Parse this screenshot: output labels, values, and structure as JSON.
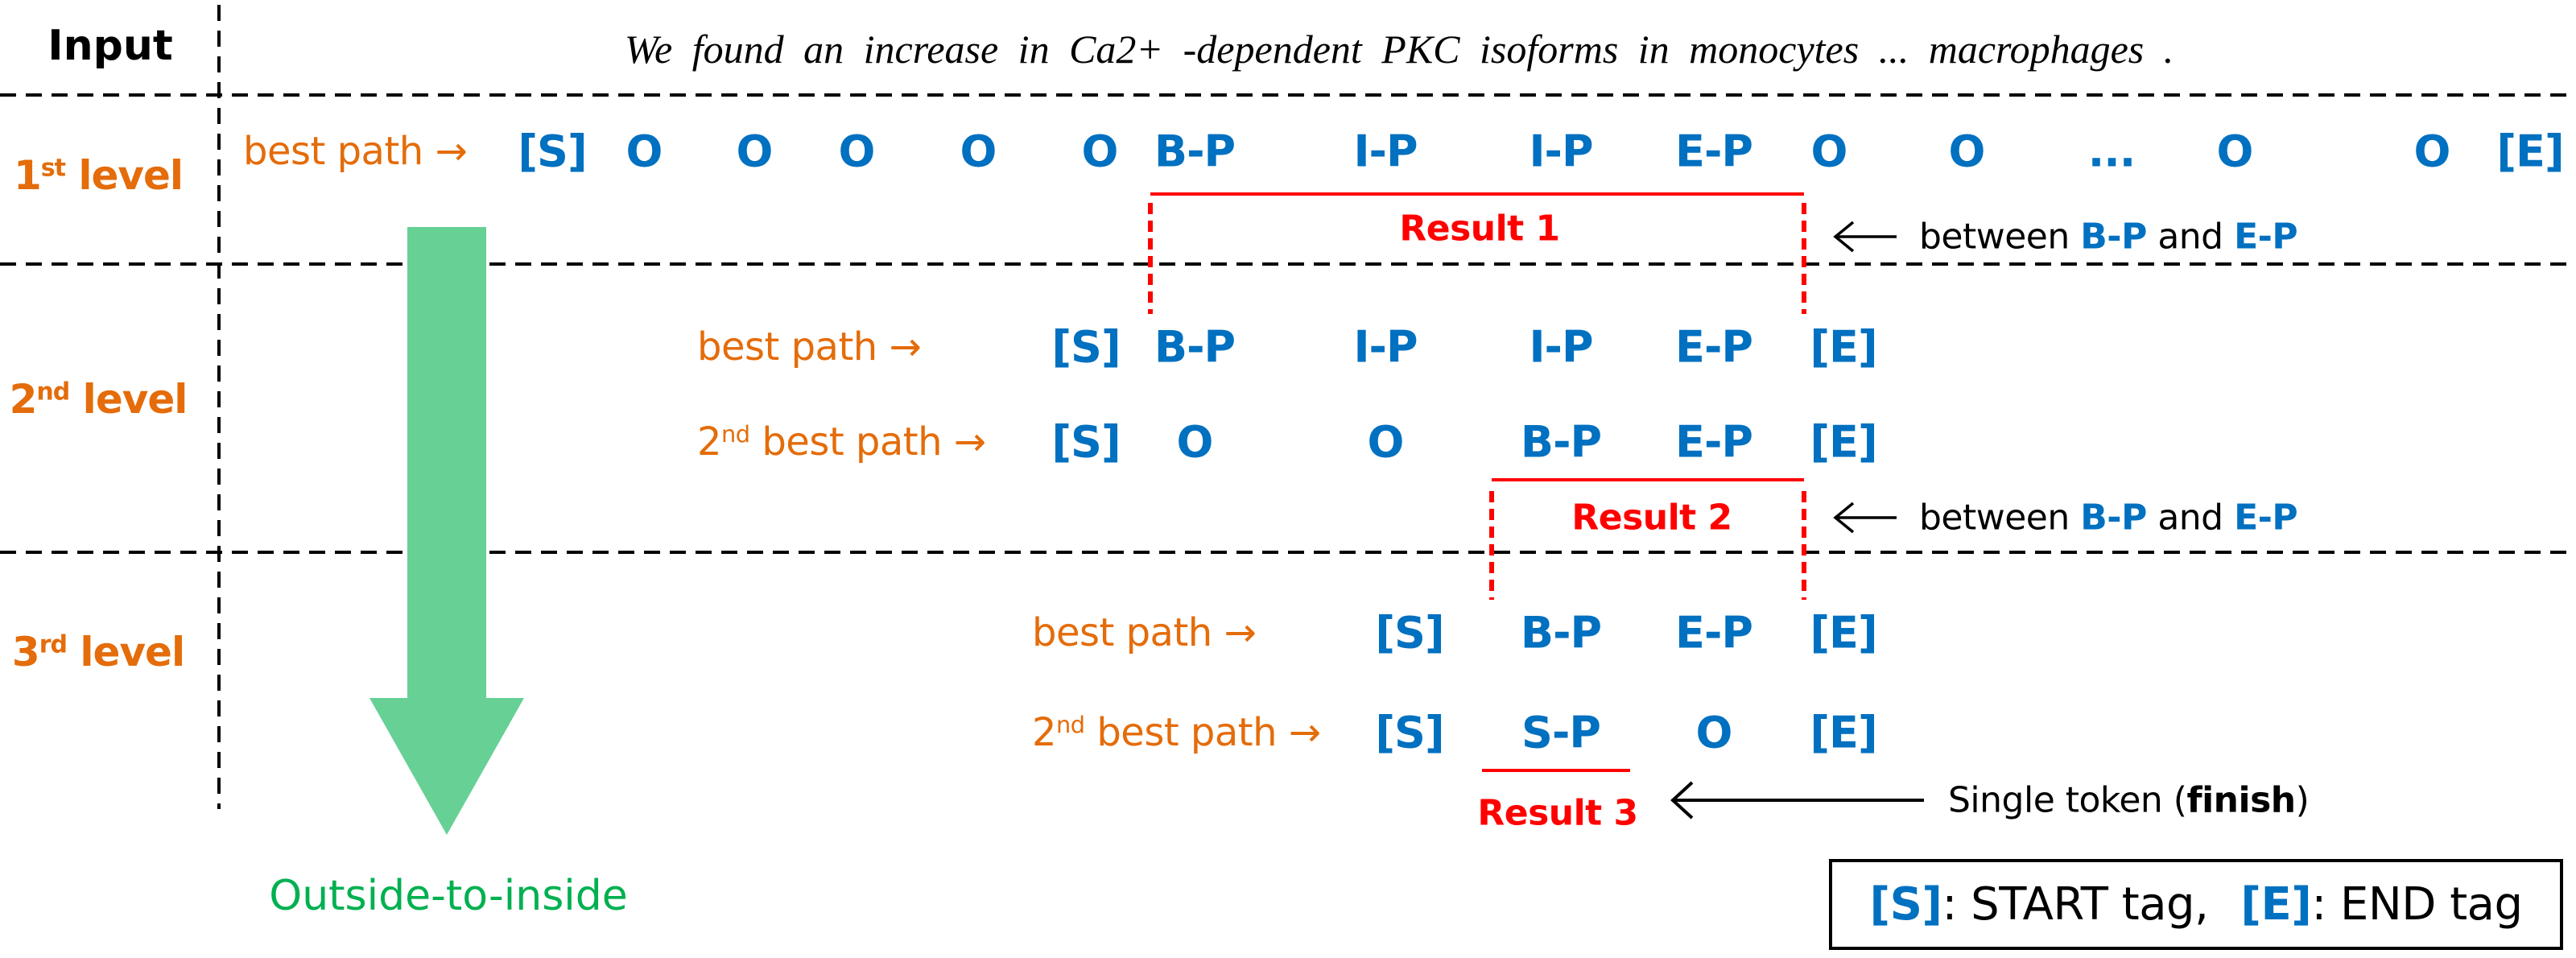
{
  "input_row": {
    "label": "Input",
    "sentence": "We found an increase in Ca2+ -dependent PKC isoforms in monocytes ... macrophages ."
  },
  "levels": [
    {
      "num": "1",
      "suffix": "st",
      "word": "level"
    },
    {
      "num": "2",
      "suffix": "nd",
      "word": "level"
    },
    {
      "num": "3",
      "suffix": "rd",
      "word": "level"
    }
  ],
  "paths": {
    "best": "best path →",
    "second_prefix": "2",
    "second_suffix": "nd",
    "second_rest": " best path →"
  },
  "level1": {
    "best_tokens": [
      "[S]",
      "O",
      "O",
      "O",
      "O",
      "O",
      "B-P",
      "I-P",
      "I-P",
      "E-P",
      "O",
      "O",
      "...",
      "O",
      "O",
      "[E]"
    ]
  },
  "level2": {
    "best_tokens": [
      "[S]",
      "B-P",
      "I-P",
      "I-P",
      "E-P",
      "[E]"
    ],
    "second_tokens": [
      "[S]",
      "O",
      "O",
      "B-P",
      "E-P",
      "[E]"
    ]
  },
  "level3": {
    "best_tokens": [
      "[S]",
      "B-P",
      "E-P",
      "[E]"
    ],
    "second_tokens": [
      "[S]",
      "S-P",
      "O",
      "[E]"
    ]
  },
  "results": [
    "Result 1",
    "Result 2",
    "Result 3"
  ],
  "notes": {
    "between_prefix": "between",
    "between_a": "B-P",
    "between_mid": "and",
    "between_b": "E-P",
    "single_prefix": "Single token (",
    "single_bold": "finish",
    "single_suffix": ")"
  },
  "flow_label": "Outside-to-inside",
  "legend": {
    "s_tag": "[S]",
    "s_desc": ": START tag,",
    "e_tag": "[E]",
    "e_desc": ": END tag"
  },
  "colors": {
    "token_blue": "#0070C0",
    "level_orange": "#E46C0A",
    "result_red": "#FF0000",
    "flow_green": "#00B050",
    "arrow_green": "#66D095"
  }
}
